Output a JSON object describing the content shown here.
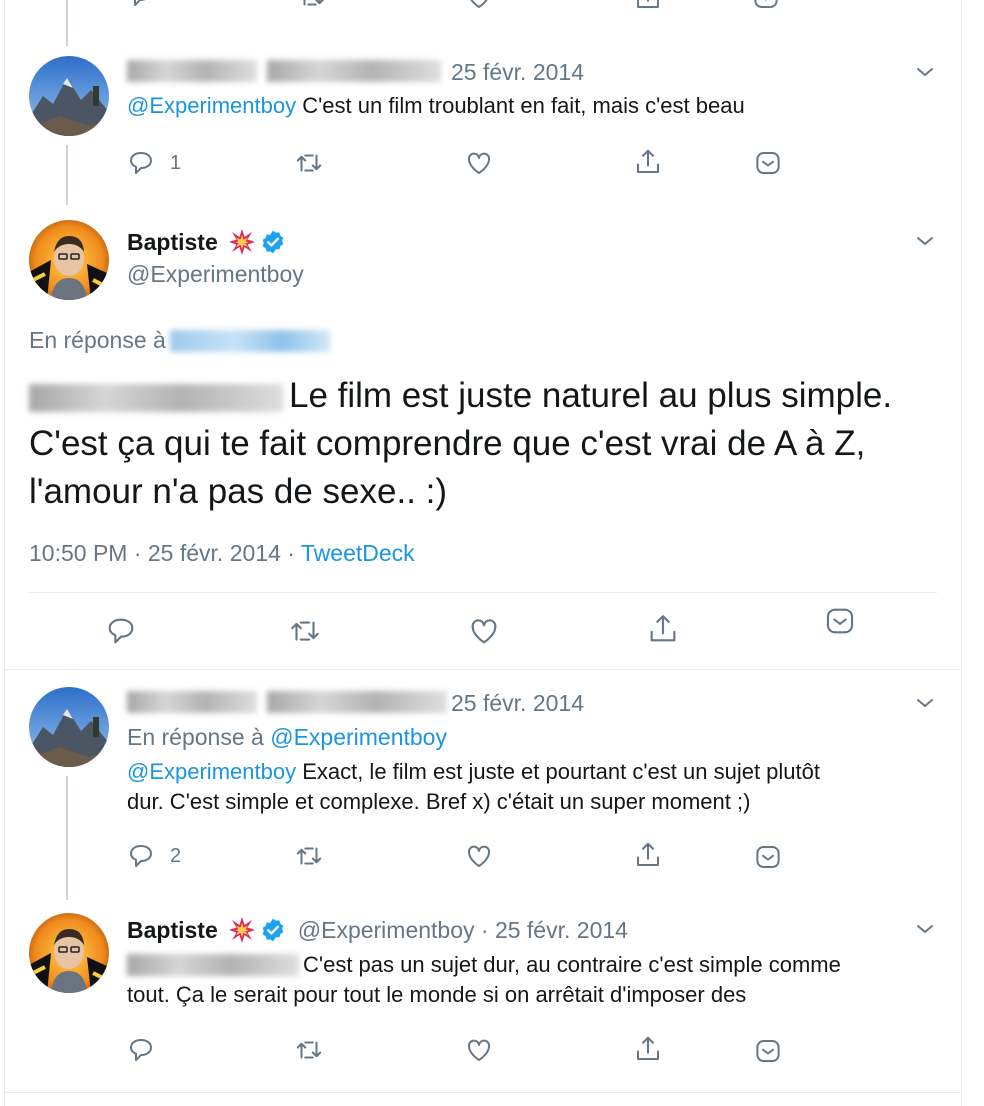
{
  "tweet1": {
    "date": "25 févr. 2014",
    "mention": "@Experimentboy",
    "text": " C'est un film troublant en fait, mais c'est beau",
    "reply_count": "1"
  },
  "main": {
    "name": "Baptiste",
    "handle": "@Experimentboy",
    "reply_prefix": "En réponse à ",
    "text_line1": "Le film est juste naturel au plus simple.",
    "text_line2": "C'est ça qui te fait comprendre que c'est vrai de A à Z,",
    "text_line3": "l'amour n'a pas de sexe.. :)",
    "time": "10:50 PM · 25 févr. 2014 · ",
    "source": "TweetDeck"
  },
  "tweet3": {
    "date": "25 févr. 2014",
    "reply_prefix": "En réponse à ",
    "reply_to": "@Experimentboy",
    "mention": "@Experimentboy",
    "text_line1": " Exact, le film est juste et pourtant c'est un sujet plutôt",
    "text_line2": "dur. C'est simple et complexe. Bref x) c'était un super moment ;)",
    "reply_count": "2"
  },
  "tweet4": {
    "name": "Baptiste",
    "handle_date": "@Experimentboy · 25 févr. 2014",
    "text_line1": "C'est pas un sujet dur, au contraire c'est simple comme",
    "text_line2": "tout. Ça le serait pour tout le monde si on arrêtait d'imposer des"
  },
  "colors": {
    "link": "#1b95e0",
    "meta": "#657786",
    "verified": "#1da1f2"
  },
  "icons": [
    "reply-icon",
    "retweet-icon",
    "like-icon",
    "share-icon",
    "caret-icon",
    "verified-icon",
    "collision-emoji"
  ]
}
